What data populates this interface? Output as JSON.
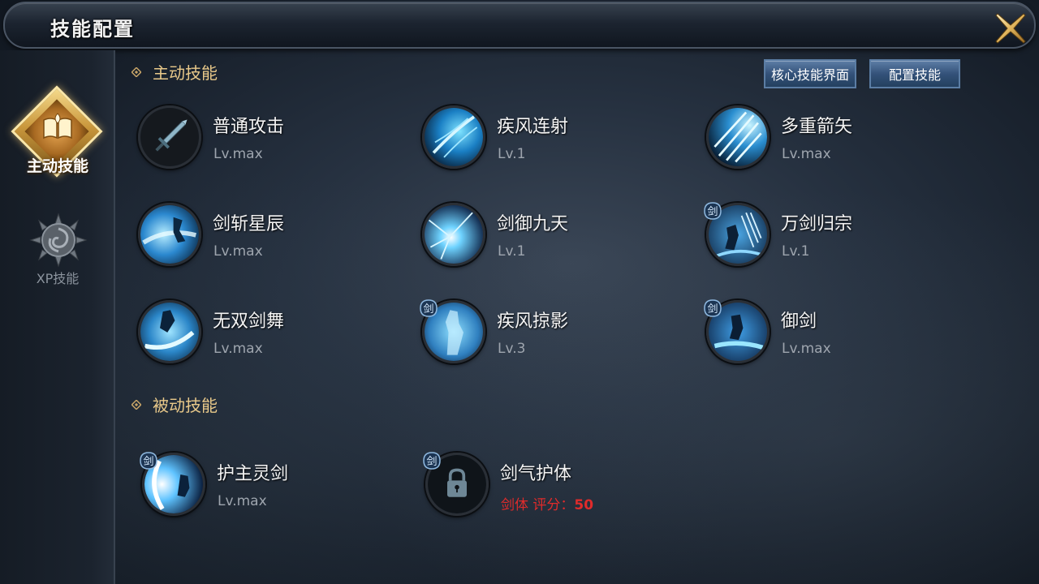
{
  "window": {
    "title": "技能配置"
  },
  "tabs": [
    {
      "label": "主动技能",
      "active": true
    },
    {
      "label": "XP技能",
      "active": false
    }
  ],
  "sections": {
    "active_title": "主动技能",
    "passive_title": "被动技能"
  },
  "buttons": {
    "core": "核心技能界面",
    "config": "配置技能"
  },
  "active_skills": [
    {
      "name": "普通攻击",
      "level": "Lv.max",
      "icon": "sword-icon"
    },
    {
      "name": "疾风连射",
      "level": "Lv.1",
      "icon": "gale-volley-icon"
    },
    {
      "name": "多重箭矢",
      "level": "Lv.max",
      "icon": "multi-arrow-icon"
    },
    {
      "name": "剑斩星辰",
      "level": "Lv.max",
      "icon": "star-slash-icon"
    },
    {
      "name": "剑御九天",
      "level": "Lv.1",
      "icon": "sky-sword-icon"
    },
    {
      "name": "万剑归宗",
      "level": "Lv.1",
      "icon": "myriad-swords-icon",
      "badge": "剑"
    },
    {
      "name": "无双剑舞",
      "level": "Lv.max",
      "icon": "sword-dance-icon"
    },
    {
      "name": "疾风掠影",
      "level": "Lv.3",
      "icon": "gale-shadow-icon",
      "badge": "剑"
    },
    {
      "name": "御剑",
      "level": "Lv.max",
      "icon": "sword-ride-icon",
      "badge": "剑"
    }
  ],
  "passive_skills": [
    {
      "name": "护主灵剑",
      "level": "Lv.max",
      "icon": "guardian-sword-icon",
      "badge": "剑"
    },
    {
      "name": "剑气护体",
      "requirement_label": "剑体 评分：",
      "requirement_value": "50",
      "icon": "lock-icon",
      "badge": "剑",
      "locked": true
    }
  ],
  "colors": {
    "section_title": "#e9c98a",
    "requirement": "#e02b2b",
    "button": "#34527a",
    "tab_active": "#c9973c"
  }
}
